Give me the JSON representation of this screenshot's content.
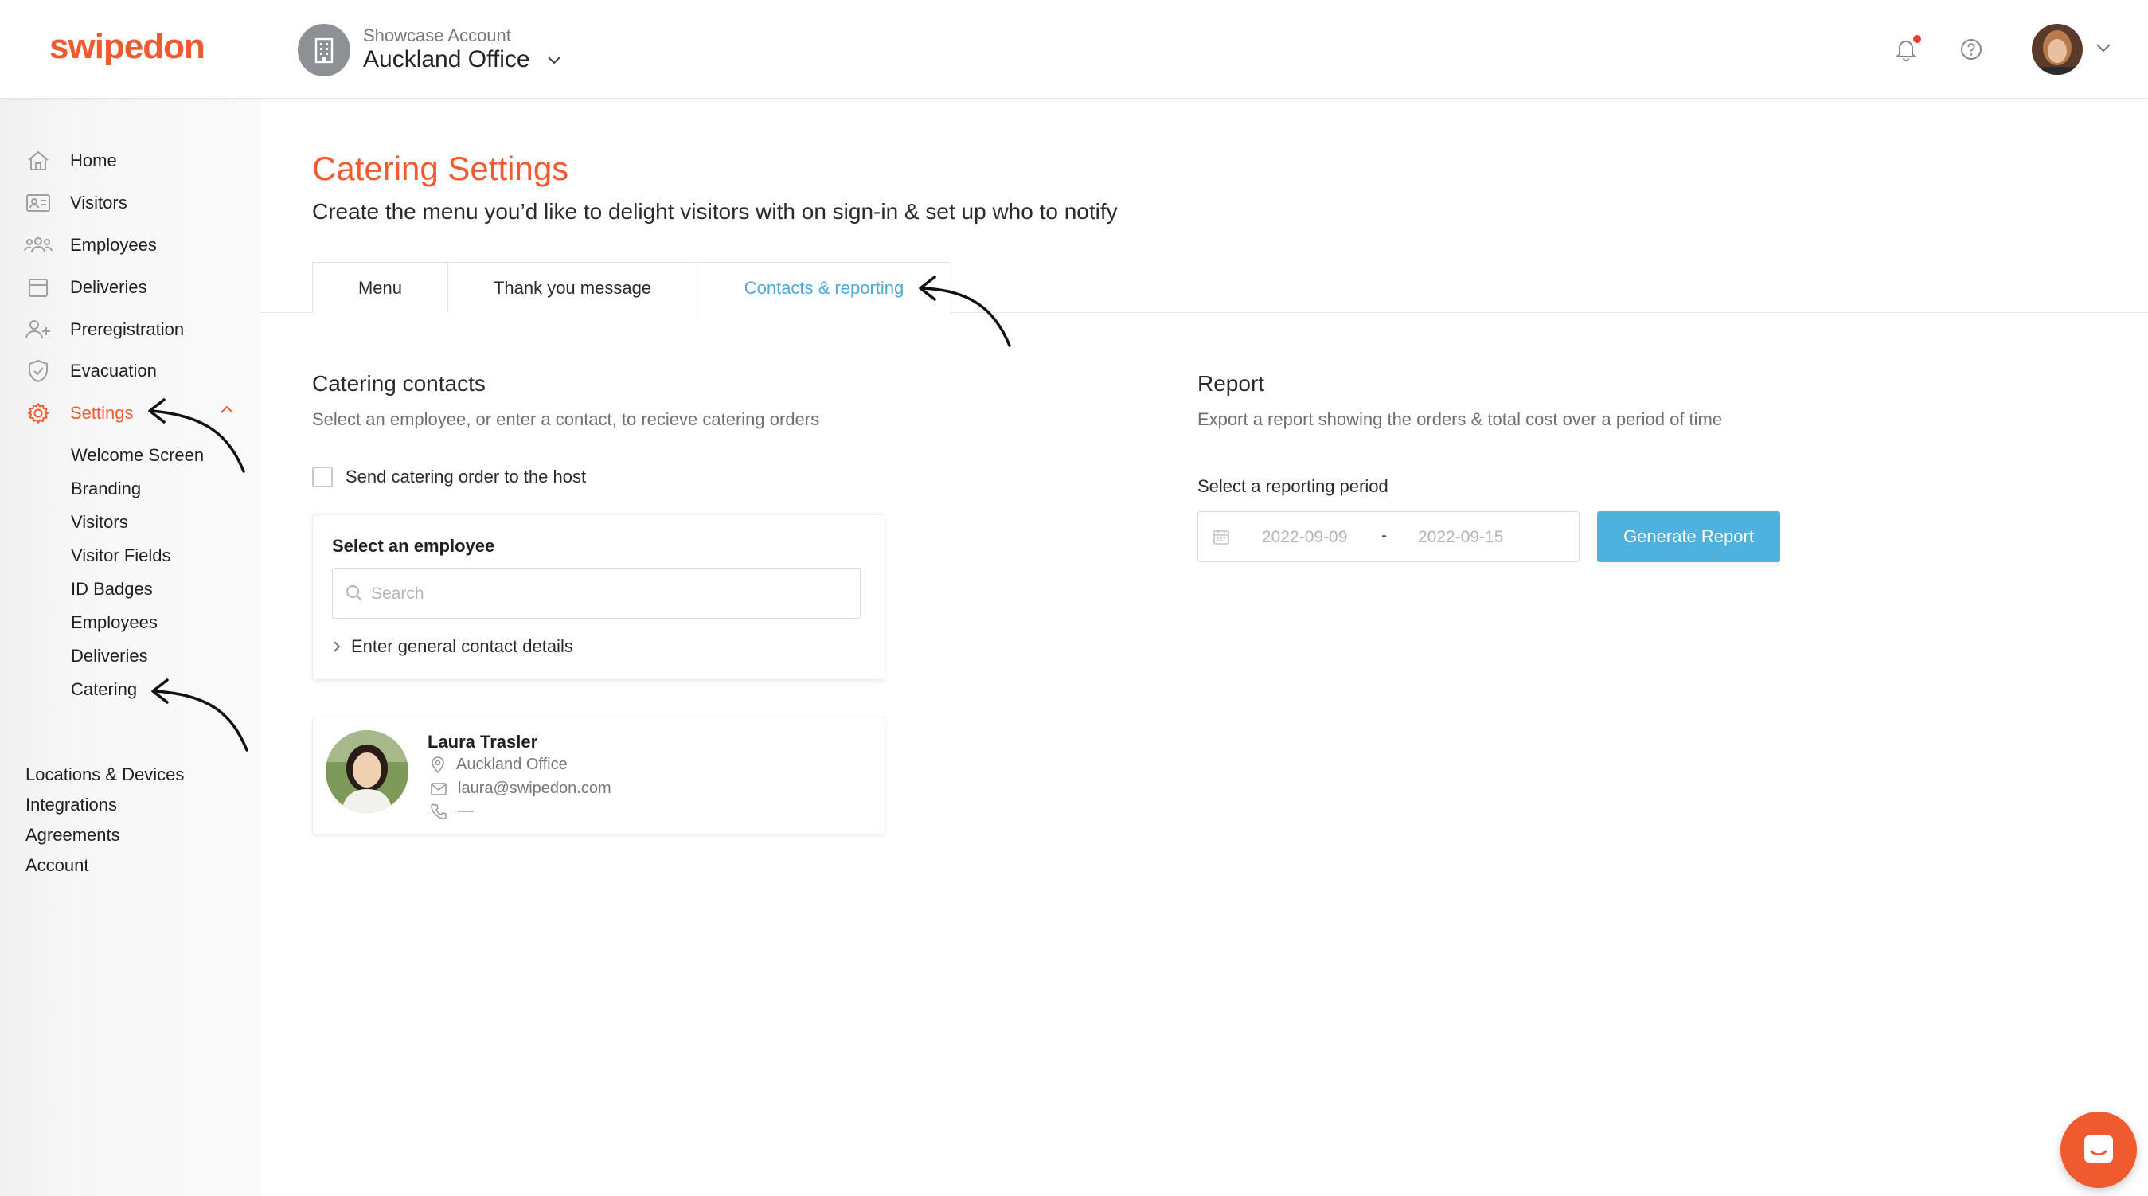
{
  "brand": {
    "logo": "swipedon",
    "accent": "#ef5b2f",
    "link": "#4ba9d6",
    "button": "#4fb2de"
  },
  "header": {
    "account_sub": "Showcase Account",
    "account_name": "Auckland Office",
    "icons": [
      "building-icon",
      "chevron-down-icon",
      "bell-icon",
      "help-icon",
      "avatar",
      "chevron-down-icon"
    ]
  },
  "sidebar": {
    "items": [
      {
        "label": "Home",
        "icon": "home-icon"
      },
      {
        "label": "Visitors",
        "icon": "id-card-icon"
      },
      {
        "label": "Employees",
        "icon": "people-icon"
      },
      {
        "label": "Deliveries",
        "icon": "box-icon"
      },
      {
        "label": "Preregistration",
        "icon": "add-user-icon"
      },
      {
        "label": "Evacuation",
        "icon": "shield-icon"
      },
      {
        "label": "Settings",
        "icon": "gear-icon",
        "active": true
      }
    ],
    "sub_items": [
      "Welcome Screen",
      "Branding",
      "Visitors",
      "Visitor Fields",
      "ID Badges",
      "Employees",
      "Deliveries",
      "Catering"
    ],
    "bottom_items": [
      "Locations & Devices",
      "Integrations",
      "Agreements",
      "Account"
    ]
  },
  "main": {
    "title": "Catering Settings",
    "subtitle": "Create the menu you’d like to delight visitors with on sign-in & set up who to notify",
    "tabs": [
      {
        "label": "Menu",
        "active": false
      },
      {
        "label": "Thank you message",
        "active": false
      },
      {
        "label": "Contacts & reporting",
        "active": true
      }
    ]
  },
  "contacts": {
    "title": "Catering contacts",
    "description": "Select an employee, or enter a contact, to recieve catering orders",
    "checkbox_label": "Send catering order to the host",
    "checkbox_checked": false,
    "select_title": "Select an employee",
    "search_placeholder": "Search",
    "general_contact_label": "Enter general contact details",
    "person": {
      "name": "Laura Trasler",
      "location": "Auckland Office",
      "email": "laura@swipedon.com",
      "phone": "—"
    }
  },
  "report": {
    "title": "Report",
    "description": "Export a report showing the orders & total cost over a period of time",
    "period_label": "Select a reporting period",
    "start_date": "2022-09-09",
    "separator": "-",
    "end_date": "2022-09-15",
    "button_label": "Generate Report"
  }
}
